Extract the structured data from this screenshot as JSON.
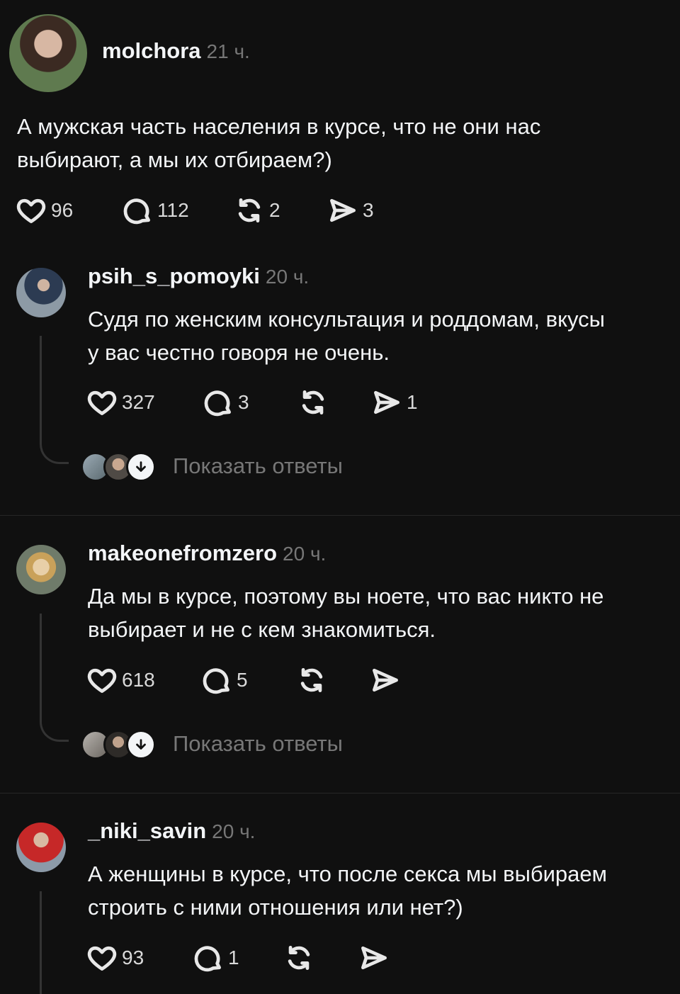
{
  "posts": [
    {
      "username": "molchora",
      "time": "21 ч.",
      "text_lines": [
        "А мужская часть населения в курсе, что не они нас",
        "выбирают, а мы их отбираем?)"
      ],
      "likes": "96",
      "comments": "112",
      "reposts": "2",
      "shares": "3"
    },
    {
      "username": "psih_s_pomoyki",
      "time": "20 ч.",
      "text_lines": [
        "Судя по женским консультация и роддомам, вкусы",
        "у вас честно говоря не очень."
      ],
      "likes": "327",
      "comments": "3",
      "reposts": "",
      "shares": "1",
      "show_replies": "Показать ответы"
    },
    {
      "username": "makeonefromzero",
      "time": "20 ч.",
      "text_lines": [
        "Да мы в курсе, поэтому вы ноете, что вас никто не",
        "выбирает и не с кем знакомиться."
      ],
      "likes": "618",
      "comments": "5",
      "reposts": "",
      "shares": "",
      "show_replies": "Показать ответы"
    },
    {
      "username": "_niki_savin",
      "time": "20 ч.",
      "text_lines": [
        "А женщины в курсе, что после секса мы выбираем",
        "строить с ними отношения или нет?)"
      ],
      "likes": "93",
      "comments": "1",
      "reposts": "",
      "shares": ""
    }
  ],
  "icons": {
    "like": "heart-icon",
    "comment": "comment-icon",
    "repost": "repost-icon",
    "share": "share-icon",
    "expand": "arrow-down-icon"
  },
  "colors": {
    "background": "#101010",
    "text": "#f3f5f7",
    "muted": "#777777",
    "line": "#333333"
  }
}
